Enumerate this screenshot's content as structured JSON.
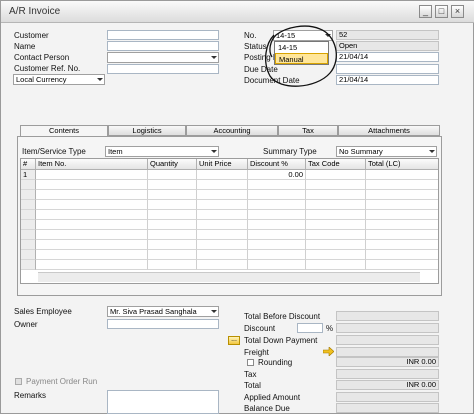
{
  "window": {
    "title": "A/R Invoice"
  },
  "header_left": {
    "customer_label": "Customer",
    "name_label": "Name",
    "contact_label": "Contact Person",
    "ref_label": "Customer Ref. No.",
    "currency_value": "Local Currency"
  },
  "header_right": {
    "no_label": "No.",
    "series_value": "14-15",
    "no_value": "52",
    "status_label": "Status",
    "status_value": "Open",
    "posting_label": "Posting Date",
    "posting_value": "21/04/14",
    "due_label": "Due Date",
    "doc_date_label": "Document Date",
    "doc_date_value": "21/04/14",
    "series_options": [
      "14-15",
      "Manual"
    ]
  },
  "tabs": [
    "Contents",
    "Logistics",
    "Accounting",
    "Tax",
    "Attachments"
  ],
  "contents": {
    "item_type_label": "Item/Service Type",
    "item_type_value": "Item",
    "summary_label": "Summary Type",
    "summary_value": "No Summary",
    "columns": [
      "#",
      "Item No.",
      "Quantity",
      "Unit Price",
      "Discount %",
      "Tax Code",
      "Total (LC)"
    ],
    "row1": {
      "num": "1",
      "discount": "0.00"
    }
  },
  "footer_left": {
    "sales_emp_label": "Sales Employee",
    "sales_emp_value": "Mr. Siva Prasad Sanghala",
    "owner_label": "Owner",
    "payment_run_label": "Payment Order Run",
    "remarks_label": "Remarks"
  },
  "footer_right": {
    "total_before_label": "Total Before Discount",
    "discount_label": "Discount",
    "percent_sign": "%",
    "down_payment_label": "Total Down Payment",
    "freight_label": "Freight",
    "rounding_label": "Rounding",
    "rounding_value": "INR 0.00",
    "tax_label": "Tax",
    "total_label": "Total",
    "total_value": "INR 0.00",
    "applied_label": "Applied Amount",
    "balance_label": "Balance Due",
    "dots_label": "..."
  },
  "icons": {
    "minimize": "minimize-icon",
    "restore": "restore-icon",
    "close": "close-icon"
  },
  "colors": {
    "highlight": "#ffe69a",
    "field_border": "#a9b6c4"
  }
}
